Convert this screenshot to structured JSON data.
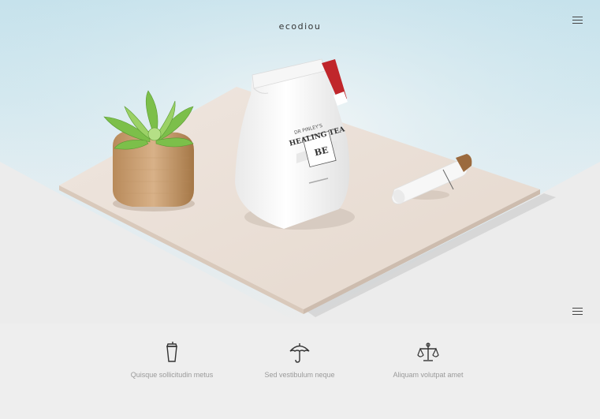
{
  "header": {
    "brand": "ecodiou",
    "menu_icon": "hamburger-menu-icon"
  },
  "hero": {
    "bag_label_top": "DR PINLEY'S",
    "bag_label_title": "HEALING TEA",
    "bag_monogram": "BE"
  },
  "features": [
    {
      "icon": "cup-icon",
      "label": "Quisque sollicitudin metus"
    },
    {
      "icon": "umbrella-icon",
      "label": "Sed vestibulum neque"
    },
    {
      "icon": "scale-icon",
      "label": "Aliquam volutpat amet"
    }
  ],
  "colors": {
    "sky": "#c6e2ec",
    "board": "#eadfd6",
    "page": "#eeeeee",
    "text_muted": "#9a9a9a"
  }
}
